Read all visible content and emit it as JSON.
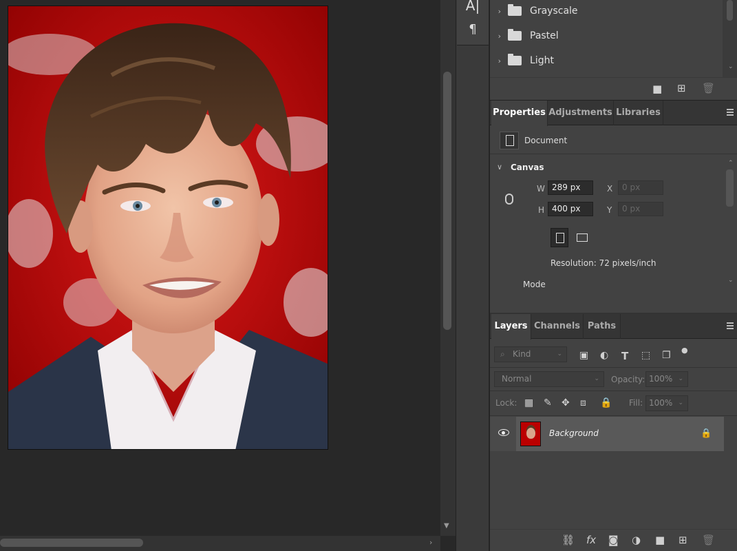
{
  "swatches": {
    "groups": [
      {
        "label": "Grayscale"
      },
      {
        "label": "Pastel"
      },
      {
        "label": "Light"
      }
    ]
  },
  "properties": {
    "tabs": [
      "Properties",
      "Adjustments",
      "Libraries"
    ],
    "doc_label": "Document",
    "canvas_title": "Canvas",
    "w_label": "W",
    "h_label": "H",
    "x_label": "X",
    "y_label": "Y",
    "w_value": "289 px",
    "h_value": "400 px",
    "x_placeholder": "0 px",
    "y_placeholder": "0 px",
    "resolution": "Resolution: 72 pixels/inch",
    "mode_label": "Mode"
  },
  "layers": {
    "tabs": [
      "Layers",
      "Channels",
      "Paths"
    ],
    "filter_kind": "Kind",
    "blend_mode": "Normal",
    "opacity_label": "Opacity:",
    "opacity_value": "100%",
    "lock_label": "Lock:",
    "fill_label": "Fill:",
    "fill_value": "100%",
    "items": [
      {
        "name": "Background",
        "visible": true,
        "locked": true
      }
    ]
  },
  "icons": {
    "character": "A|",
    "paragraph": "¶",
    "fx": "fx"
  }
}
